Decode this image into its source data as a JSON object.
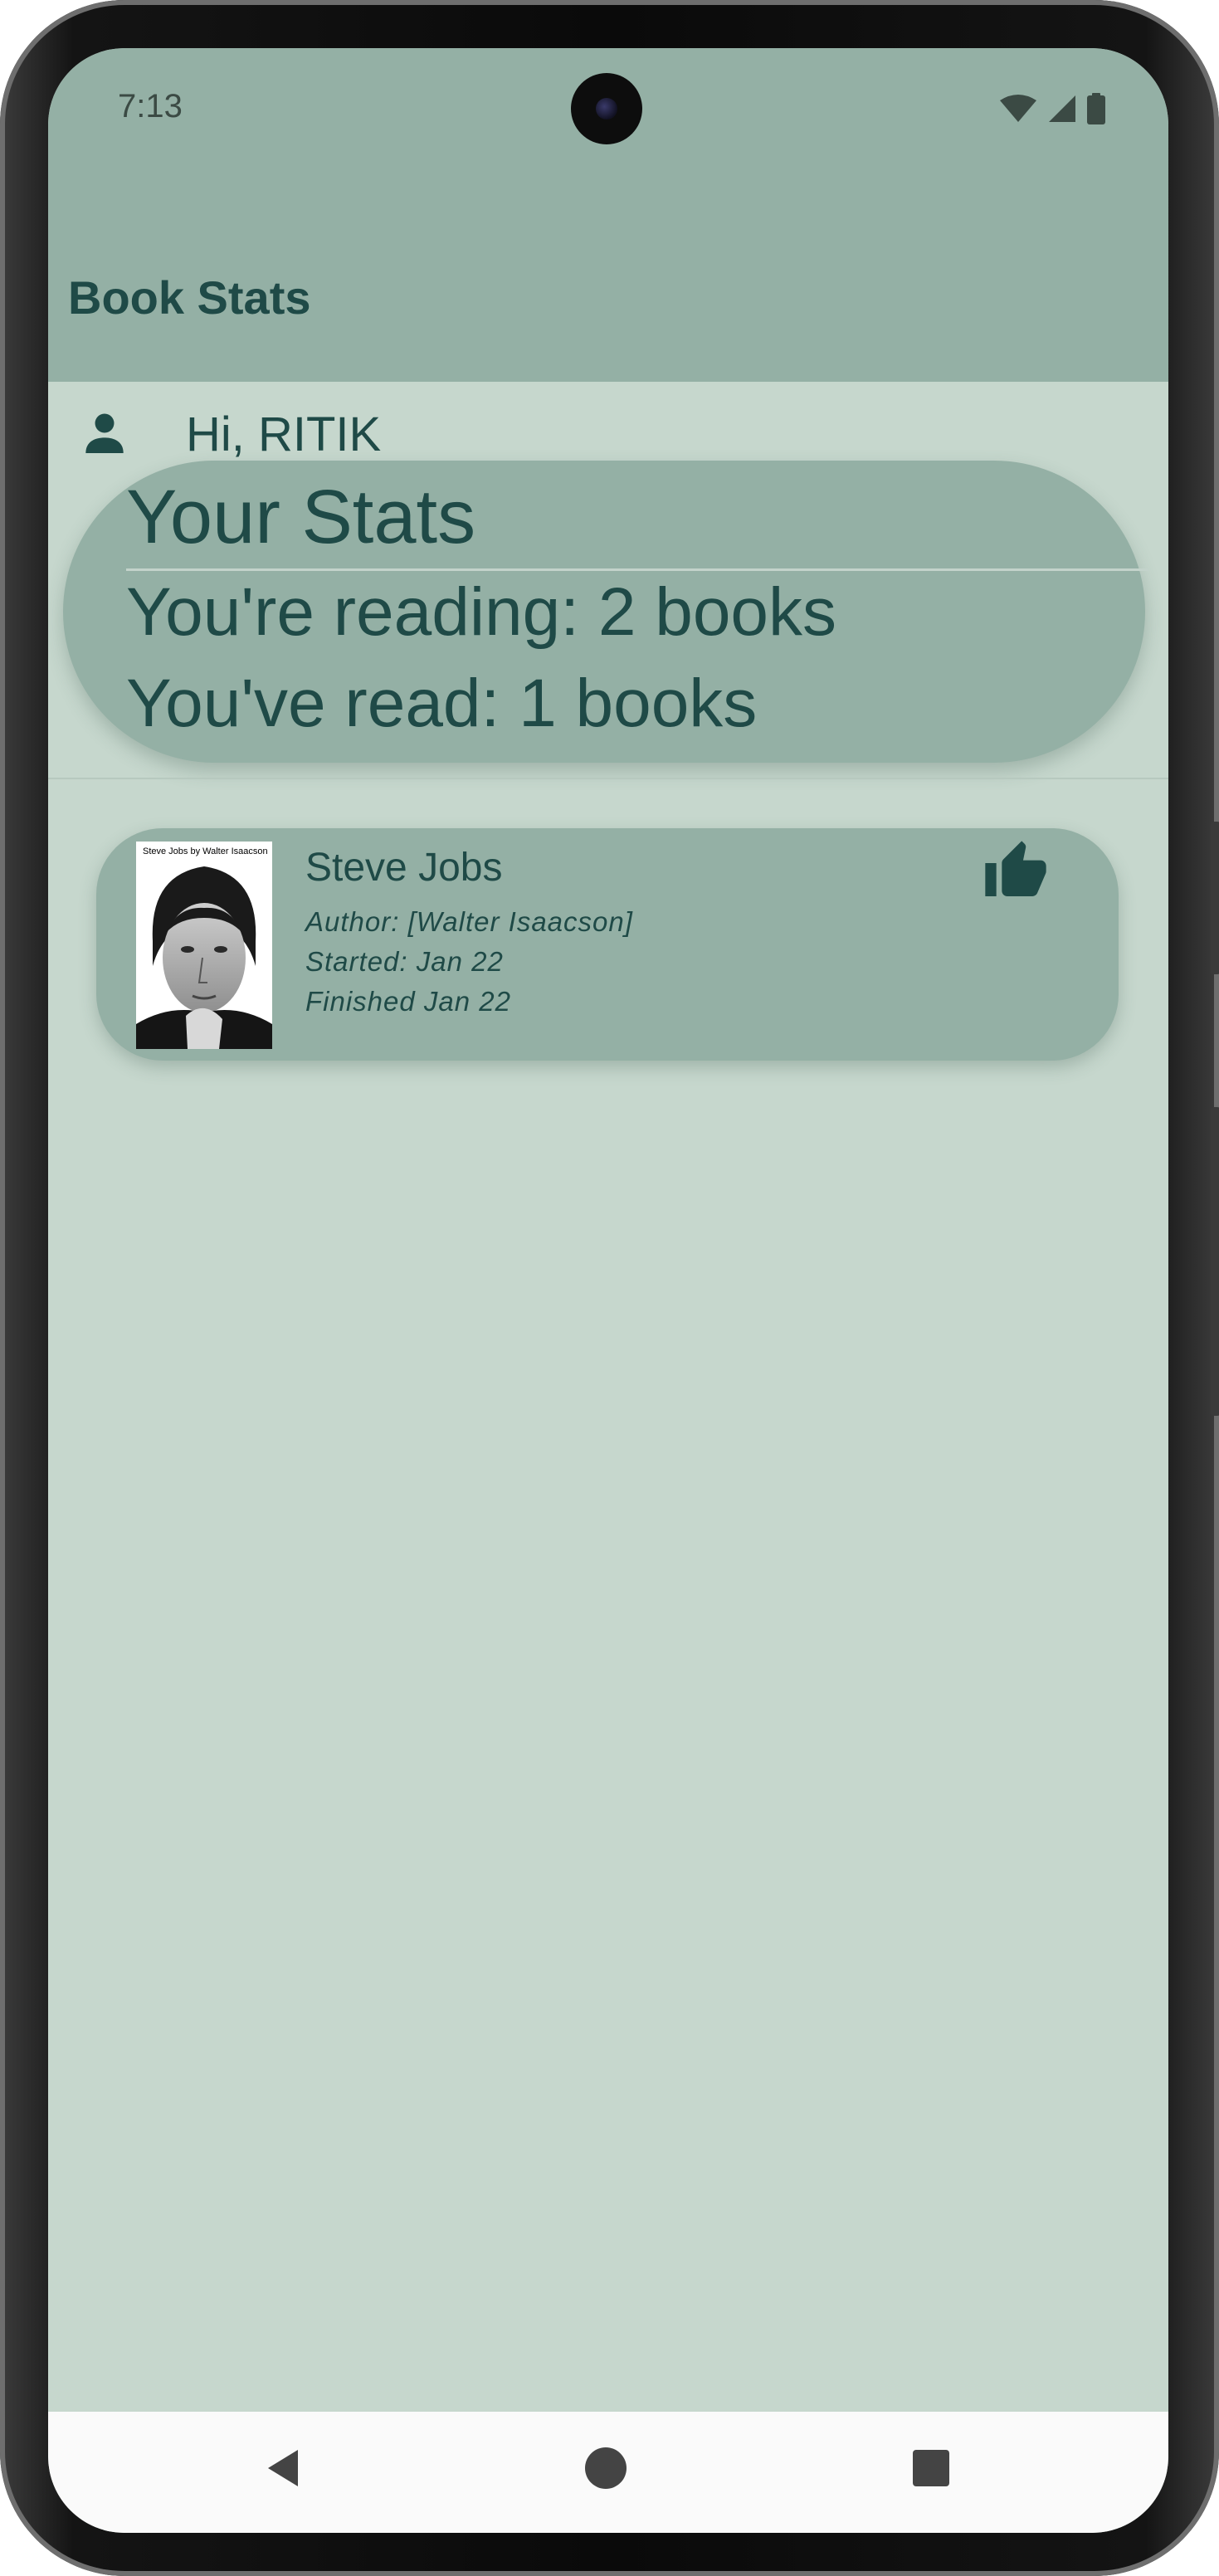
{
  "status_bar": {
    "time": "7:13"
  },
  "app_bar": {
    "title": "Book Stats"
  },
  "greeting": {
    "icon": "person-icon",
    "text": "Hi, RITIK"
  },
  "stats": {
    "title": "Your Stats",
    "reading_line": "You're reading: 2 books",
    "read_line": "You've read: 1 books"
  },
  "books": [
    {
      "title": "Steve Jobs",
      "author": "Author: [Walter Isaacson]",
      "started": "Started: Jan 22",
      "finished": "Finished Jan 22",
      "cover_text": "Steve Jobs by Walter Isaacson",
      "rating_icon": "thumb-up-icon"
    }
  ],
  "nav": {
    "back_icon": "back-triangle-icon",
    "home_icon": "home-circle-icon",
    "recents_icon": "recents-square-icon"
  },
  "colors": {
    "app_bar": "#94b0a5",
    "background": "#c6d7cd",
    "text_primary": "#1f4a47"
  }
}
